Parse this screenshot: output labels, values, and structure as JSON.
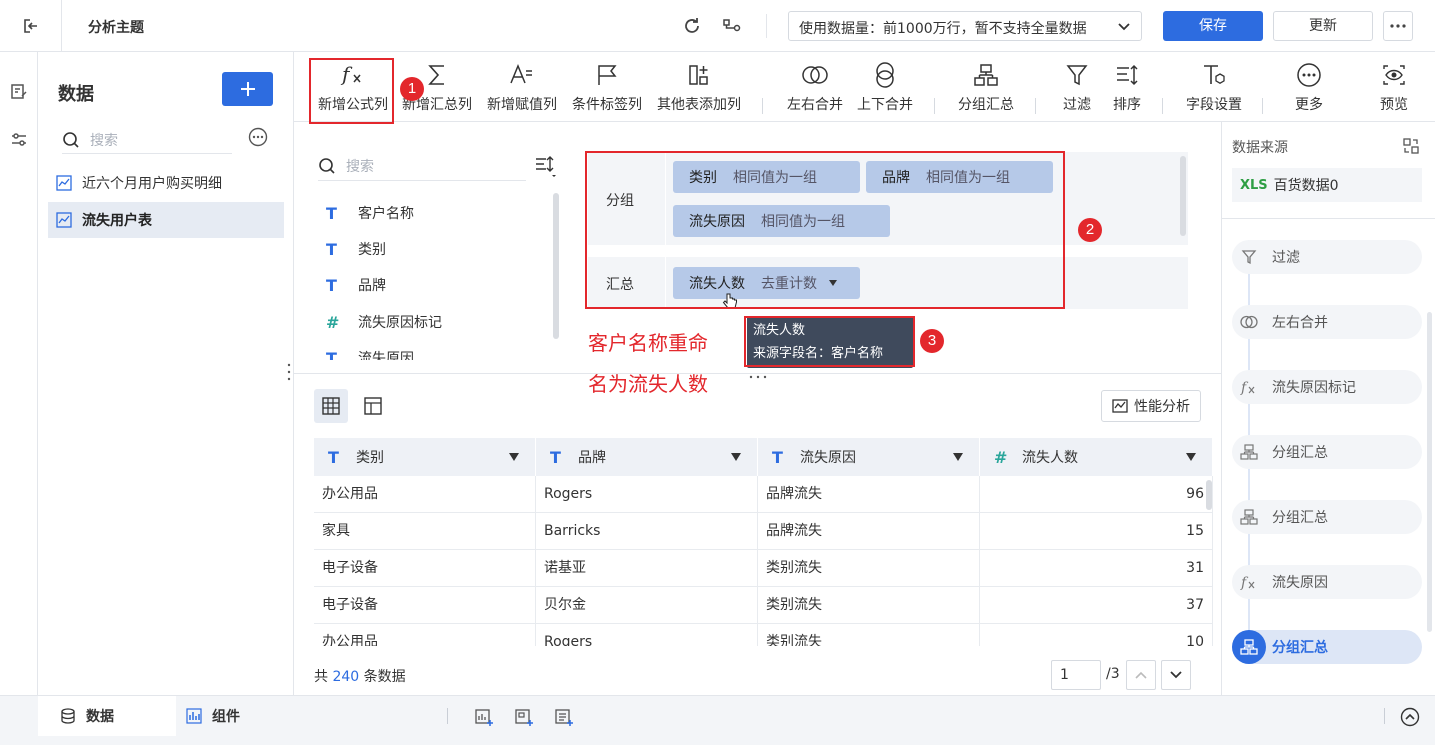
{
  "header": {
    "title": "分析主题",
    "data_volume": "使用数据量：前1000万行，暂不支持全量数据",
    "save_label": "保存",
    "update_label": "更新"
  },
  "data_panel": {
    "title": "数据",
    "search_placeholder": "搜索",
    "tables": [
      "近六个月用户购买明细",
      "流失用户表"
    ]
  },
  "toolbar": {
    "items": [
      "新增公式列",
      "新增汇总列",
      "新增赋值列",
      "条件标签列",
      "其他表添加列",
      "左右合并",
      "上下合并",
      "分组汇总",
      "过滤",
      "排序",
      "字段设置",
      "更多",
      "预览"
    ]
  },
  "fields": {
    "search_placeholder": "搜索",
    "items": [
      "客户名称",
      "类别",
      "品牌",
      "流失原因标记",
      "流失原因"
    ]
  },
  "config": {
    "group_label": "分组",
    "summary_label": "汇总",
    "group_chips": [
      {
        "name": "类别",
        "tag": "相同值为一组"
      },
      {
        "name": "品牌",
        "tag": "相同值为一组"
      },
      {
        "name": "流失原因",
        "tag": "相同值为一组"
      }
    ],
    "summary_chip": {
      "name": "流失人数",
      "tag": "去重计数"
    }
  },
  "annotations": {
    "badge1": "1",
    "badge2": "2",
    "badge3": "3",
    "note_line1": "客户名称重命",
    "note_line2": "名为流失人数"
  },
  "tooltip": {
    "line1": "流失人数",
    "line2": "来源字段名：客户名称"
  },
  "preview": {
    "perf_label": "性能分析",
    "columns": [
      "类别",
      "品牌",
      "流失原因",
      "流失人数"
    ],
    "rows": [
      [
        "办公用品",
        "Rogers",
        "品牌流失",
        "96"
      ],
      [
        "家具",
        "Barricks",
        "品牌流失",
        "15"
      ],
      [
        "电子设备",
        "诺基亚",
        "类别流失",
        "31"
      ],
      [
        "电子设备",
        "贝尔金",
        "类别流失",
        "37"
      ],
      [
        "办公用品",
        "Rogers",
        "类别流失",
        "10"
      ]
    ],
    "total_prefix": "共",
    "total_count": "240",
    "total_suffix": "条数据",
    "page": "1",
    "page_total": "/3"
  },
  "pipeline": {
    "title": "数据来源",
    "source_badge": "XLS",
    "source": "百货数据0",
    "steps": [
      "过滤",
      "左右合并",
      "流失原因标记",
      "分组汇总",
      "分组汇总",
      "流失原因",
      "分组汇总"
    ]
  },
  "bottom": {
    "tab_data": "数据",
    "tab_component": "组件"
  },
  "colors": {
    "primary": "#2d6ce0",
    "annotation_red": "#e3272c",
    "chip": "#b6c9e8"
  }
}
